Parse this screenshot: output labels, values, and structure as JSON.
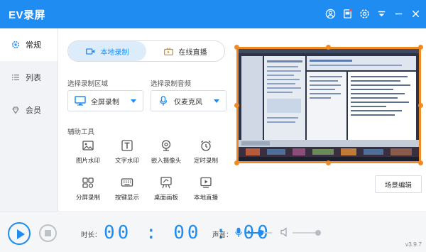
{
  "app": {
    "title": "EV录屏"
  },
  "titlebar": {
    "icons": [
      "user-icon",
      "gift-icon",
      "settings-icon",
      "menu-icon",
      "minimize-icon",
      "close-icon"
    ]
  },
  "sidebar": {
    "items": [
      {
        "label": "常规",
        "icon": "settings-icon",
        "active": true
      },
      {
        "label": "列表",
        "icon": "list-icon",
        "active": false
      },
      {
        "label": "会员",
        "icon": "diamond-icon",
        "active": false
      }
    ]
  },
  "tabs": [
    {
      "label": "本地录制",
      "icon": "video-camera-icon",
      "active": true
    },
    {
      "label": "在线直播",
      "icon": "tv-icon",
      "active": false
    }
  ],
  "region": {
    "label": "选择录制区域",
    "value": "全屏录制",
    "icon": "monitor-icon"
  },
  "audio": {
    "label": "选择录制音频",
    "value": "仅麦克风",
    "icon": "microphone-icon"
  },
  "tools": {
    "label": "辅助工具",
    "items": [
      {
        "label": "图片水印",
        "icon": "image-icon"
      },
      {
        "label": "文字水印",
        "icon": "text-icon"
      },
      {
        "label": "嵌入摄像头",
        "icon": "webcam-icon"
      },
      {
        "label": "定时录制",
        "icon": "alarm-clock-icon"
      },
      {
        "label": "分屏录制",
        "icon": "split-screen-icon"
      },
      {
        "label": "按键显示",
        "icon": "keyboard-icon"
      },
      {
        "label": "桌面画板",
        "icon": "drawing-board-icon"
      },
      {
        "label": "本地直播",
        "icon": "live-stream-icon"
      }
    ]
  },
  "preview": {
    "frame_color": "#f08a24"
  },
  "scene_button": "场景编辑",
  "bottom": {
    "duration_label": "时长：",
    "timer": "00:00:00",
    "volume_label": "声音：",
    "mic_level": 0.55,
    "speaker_level": 1.0
  },
  "version": "v3.9.7",
  "colors": {
    "accent": "#1e8cf0",
    "frame": "#f08a24"
  }
}
